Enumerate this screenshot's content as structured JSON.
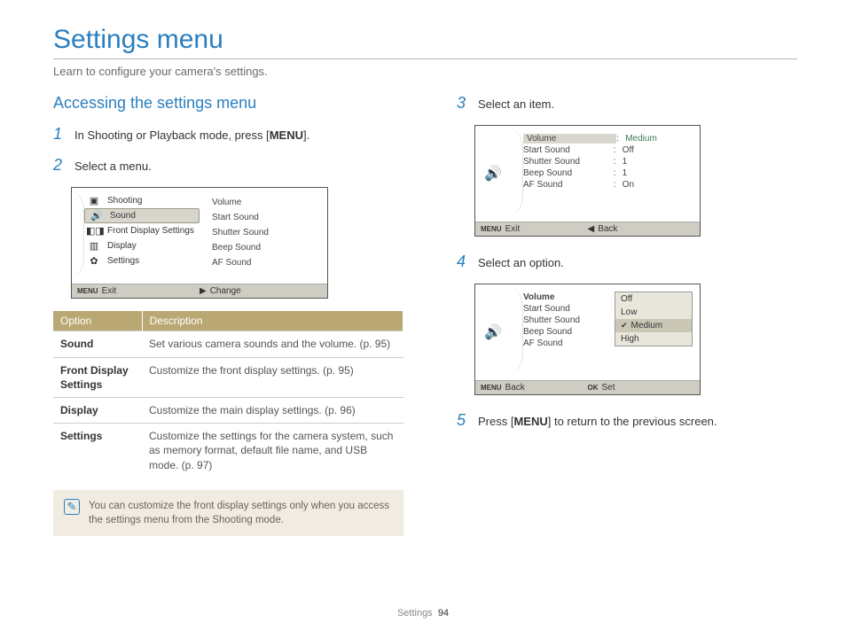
{
  "page": {
    "title": "Settings menu",
    "subtitle": "Learn to configure your camera's settings.",
    "footer_label": "Settings",
    "footer_page": "94"
  },
  "left": {
    "section_title": "Accessing the settings menu",
    "step1_a": "In Shooting or Playback mode, press [",
    "step1_menu": "MENU",
    "step1_b": "].",
    "step2": "Select a menu.",
    "screen1": {
      "left_items": [
        "Shooting",
        "Sound",
        "Front Display Settings",
        "Display",
        "Settings"
      ],
      "right_items": [
        "Volume",
        "Start Sound",
        "Shutter Sound",
        "Beep Sound",
        "AF Sound"
      ],
      "footer_left_tag": "MENU",
      "footer_left": "Exit",
      "footer_right_glyph": "▶",
      "footer_right": "Change"
    },
    "table": {
      "head_option": "Option",
      "head_desc": "Description",
      "rows": [
        {
          "opt": "Sound",
          "desc": "Set various camera sounds and the volume. (p. 95)"
        },
        {
          "opt": "Front Display Settings",
          "desc": "Customize the front display settings. (p. 95)"
        },
        {
          "opt": "Display",
          "desc": "Customize the main display settings. (p. 96)"
        },
        {
          "opt": "Settings",
          "desc": "Customize the settings for the camera system, such as memory format, default file name, and USB mode. (p. 97)"
        }
      ]
    },
    "note": "You can customize the front display settings only when you access the settings menu from the Shooting mode."
  },
  "right": {
    "step3": "Select an item.",
    "screen3": {
      "rows": [
        {
          "label": "Volume",
          "val": "Medium",
          "sel": true
        },
        {
          "label": "Start Sound",
          "val": "Off"
        },
        {
          "label": "Shutter Sound",
          "val": "1"
        },
        {
          "label": "Beep Sound",
          "val": "1"
        },
        {
          "label": "AF Sound",
          "val": "On"
        }
      ],
      "footer_left_tag": "MENU",
      "footer_left": "Exit",
      "footer_right_glyph": "◀",
      "footer_right": "Back"
    },
    "step4": "Select an option.",
    "screen4": {
      "rows": [
        "Volume",
        "Start Sound",
        "Shutter Sound",
        "Beep Sound",
        "AF Sound"
      ],
      "popup": [
        "Off",
        "Low",
        "Medium",
        "High"
      ],
      "popup_selected": "Medium",
      "footer_left_tag": "MENU",
      "footer_left": "Back",
      "footer_right_tag": "OK",
      "footer_right": "Set"
    },
    "step5_a": "Press [",
    "step5_menu": "MENU",
    "step5_b": "] to return to the previous screen."
  }
}
